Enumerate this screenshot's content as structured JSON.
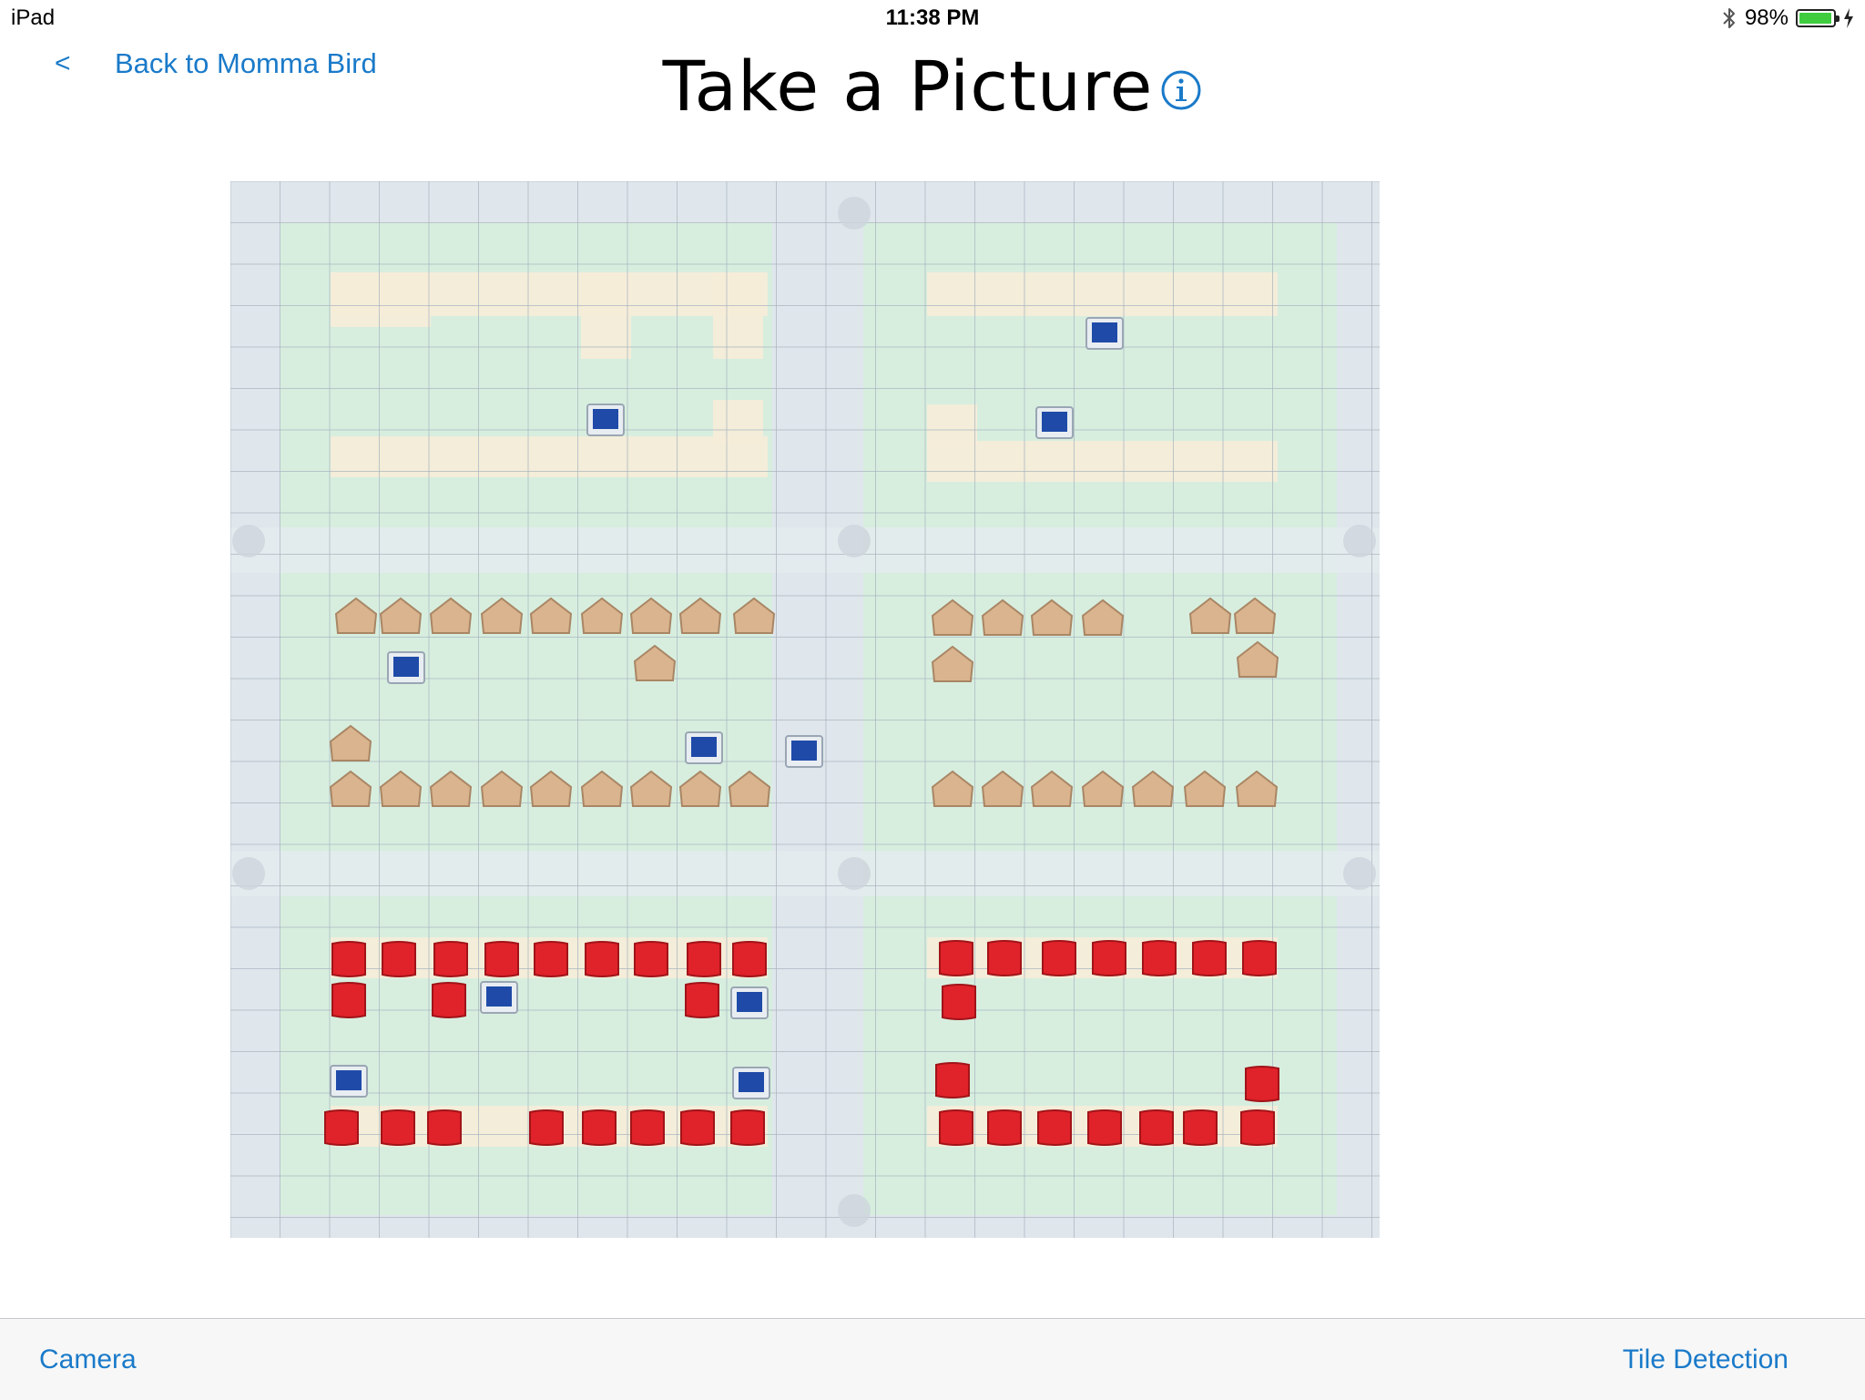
{
  "status_bar": {
    "device": "iPad",
    "time": "11:38 PM",
    "battery_percent": "98%",
    "battery_level": 0.98,
    "icons": [
      "bluetooth-icon",
      "battery-icon",
      "charging-bolt-icon"
    ]
  },
  "nav": {
    "back_label": "Back to Momma Bird",
    "back_chevron": "<",
    "title": "Take a Picture",
    "info_icon": "info-circle-icon"
  },
  "toolbar": {
    "camera_label": "Camera",
    "tile_detection_label": "Tile Detection"
  },
  "colors": {
    "accent": "#1a7ac9",
    "board_bg": "#dfe6ec",
    "board_green": "#d7eedf",
    "cell_cream": "#f6ecd8",
    "tile_blue": "#1f4aa8",
    "tile_wood": "#d9b48e",
    "tile_red": "#e0222a"
  }
}
